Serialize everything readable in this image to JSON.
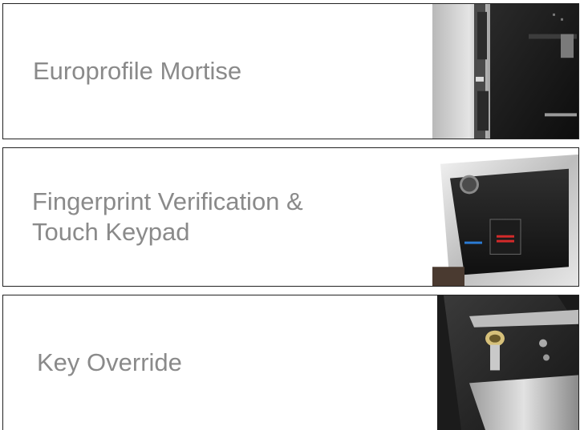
{
  "features": [
    {
      "label": "Europrofile Mortise",
      "image_icon": "mortise-lock-photo-icon"
    },
    {
      "label": "Fingerprint Verification &\nTouch Keypad",
      "image_icon": "fingerprint-reader-photo-icon"
    },
    {
      "label": "Key Override",
      "image_icon": "key-cylinder-photo-icon"
    }
  ]
}
